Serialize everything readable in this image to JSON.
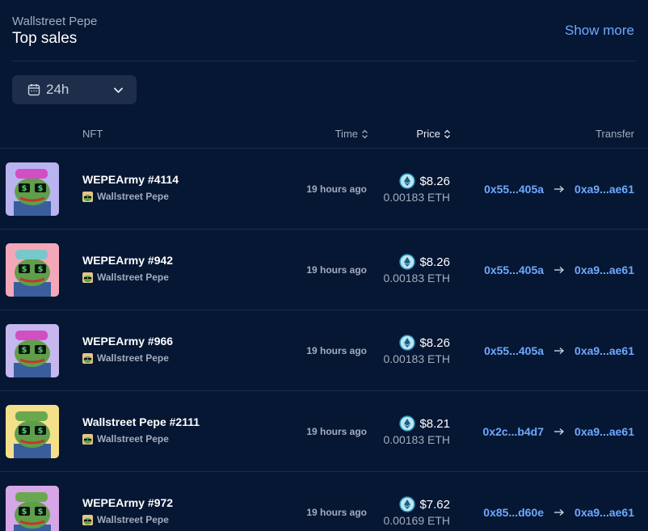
{
  "header": {
    "collection_name": "Wallstreet Pepe",
    "title": "Top sales",
    "show_more_label": "Show more"
  },
  "filter": {
    "period_label": "24h",
    "icon": "calendar-icon"
  },
  "table": {
    "columns": {
      "nft": "NFT",
      "time": "Time",
      "price": "Price",
      "transfer": "Transfer"
    },
    "rows": [
      {
        "name": "WEPEArmy #4114",
        "collection": "Wallstreet Pepe",
        "time": "19 hours ago",
        "usd": "$8.26",
        "eth": "0.00183 ETH",
        "from": "0x55...405a",
        "to": "0xa9...ae61",
        "bg": "#b9b3f0",
        "hat": "#d14fc2"
      },
      {
        "name": "WEPEArmy #942",
        "collection": "Wallstreet Pepe",
        "time": "19 hours ago",
        "usd": "$8.26",
        "eth": "0.00183 ETH",
        "from": "0x55...405a",
        "to": "0xa9...ae61",
        "bg": "#f4a7b9",
        "hat": "#79c7c9"
      },
      {
        "name": "WEPEArmy #966",
        "collection": "Wallstreet Pepe",
        "time": "19 hours ago",
        "usd": "$8.26",
        "eth": "0.00183 ETH",
        "from": "0x55...405a",
        "to": "0xa9...ae61",
        "bg": "#c6b7ef",
        "hat": "#d14fc2"
      },
      {
        "name": "Wallstreet Pepe #2111",
        "collection": "Wallstreet Pepe",
        "time": "19 hours ago",
        "usd": "$8.21",
        "eth": "0.00183 ETH",
        "from": "0x2c...b4d7",
        "to": "0xa9...ae61",
        "bg": "#f5e08a",
        "hat": "#6aa84f"
      },
      {
        "name": "WEPEArmy #972",
        "collection": "Wallstreet Pepe",
        "time": "19 hours ago",
        "usd": "$7.62",
        "eth": "0.00169 ETH",
        "from": "0x85...d60e",
        "to": "0xa9...ae61",
        "bg": "#d7a6e6",
        "hat": "#6aa84f"
      }
    ]
  },
  "colors": {
    "background": "#061733",
    "accent": "#6fa9ff",
    "muted": "#a3acbe"
  }
}
